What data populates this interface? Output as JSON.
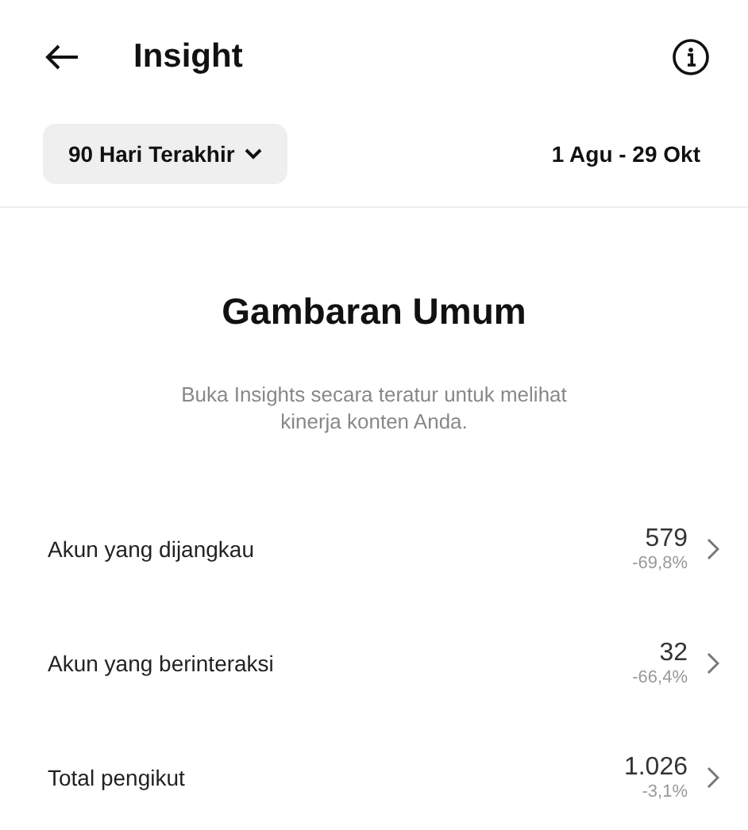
{
  "header": {
    "title": "Insight"
  },
  "filter": {
    "period": "90 Hari Terakhir",
    "date_range": "1 Agu - 29 Okt"
  },
  "overview": {
    "title": "Gambaran Umum",
    "description": "Buka Insights secara teratur untuk melihat kinerja konten Anda."
  },
  "metrics": [
    {
      "label": "Akun yang dijangkau",
      "value": "579",
      "change": "-69,8%"
    },
    {
      "label": "Akun yang berinteraksi",
      "value": "32",
      "change": "-66,4%"
    },
    {
      "label": "Total pengikut",
      "value": "1.026",
      "change": "-3,1%"
    }
  ]
}
